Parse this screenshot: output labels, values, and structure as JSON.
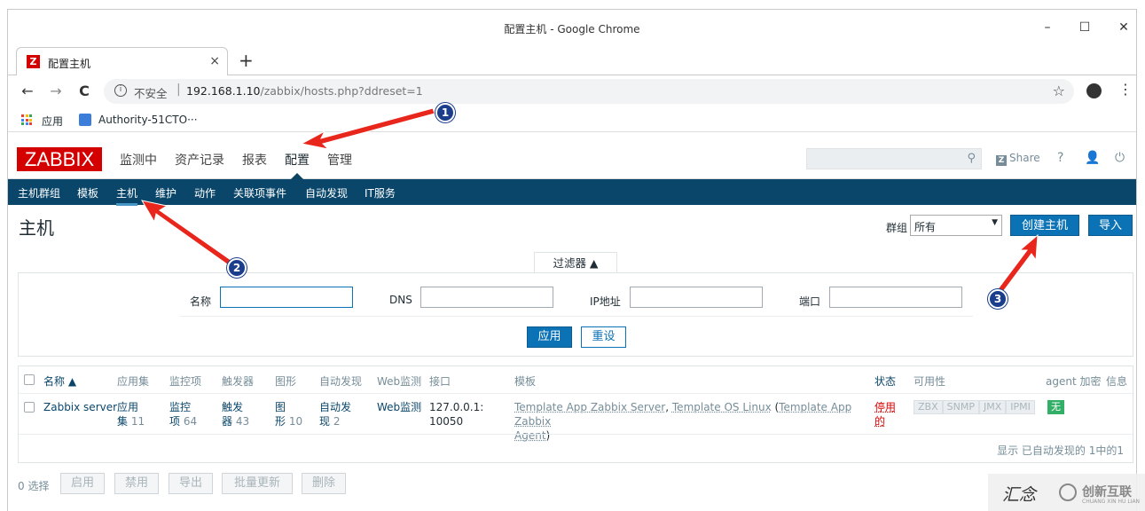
{
  "browser": {
    "window_title": "配置主机 - Google Chrome",
    "controls": {
      "minimize": "–",
      "maximize": "☐",
      "close": "✕"
    },
    "tab": {
      "favicon": "Z",
      "title": "配置主机",
      "close": "×"
    },
    "new_tab": "+",
    "nav": {
      "back": "←",
      "forward": "→",
      "reload": "C"
    },
    "address": {
      "not_secure": "不安全",
      "separator": "|",
      "host": "192.168.1.10",
      "path": "/zabbix/hosts.php?ddreset=1"
    },
    "star": "☆",
    "menu": "⋮",
    "bookmarks": {
      "apps": "应用",
      "authority": "Authority-51CTO···"
    }
  },
  "zabbix": {
    "logo": "ZABBIX",
    "main_menu": [
      "监测中",
      "资产记录",
      "报表",
      "配置",
      "管理"
    ],
    "share": "Share",
    "help": "?",
    "user": "👤",
    "power": "⏻",
    "search_icon": "⚲",
    "submenu": [
      "主机群组",
      "模板",
      "主机",
      "维护",
      "动作",
      "关联项事件",
      "自动发现",
      "IT服务"
    ],
    "page_title": "主机",
    "group_label": "群组",
    "group_value": "所有",
    "group_arrow": "▼",
    "create_host": "创建主机",
    "import": "导入",
    "filter": {
      "tab_label": "过滤器 ▲",
      "name_label": "名称",
      "dns_label": "DNS",
      "ip_label": "IP地址",
      "port_label": "端口",
      "name_value": "",
      "dns_value": "",
      "ip_value": "",
      "port_value": "",
      "apply": "应用",
      "reset": "重设"
    },
    "table": {
      "headers": {
        "name": "名称 ▲",
        "apps": "应用集",
        "items": "监控项",
        "triggers": "触发器",
        "graphs": "图形",
        "discovery": "自动发现",
        "web": "Web监测",
        "interface": "接口",
        "templates": "模板",
        "status": "状态",
        "availability": "可用性",
        "agent_encryption": "agent 加密",
        "info": "信息"
      },
      "row": {
        "name": "Zabbix server",
        "apps_l1": "应用",
        "apps_l2": "集",
        "apps_count": "11",
        "items_l1": "监控",
        "items_l2": "项",
        "items_count": "64",
        "triggers_l1": "触发",
        "triggers_l2": "器",
        "triggers_count": "43",
        "graphs_l1": "图",
        "graphs_l2": "形",
        "graphs_count": "10",
        "discovery_l1": "自动发",
        "discovery_l2": "现",
        "discovery_count": "2",
        "web": "Web监测",
        "interface_l1": "127.0.0.1:",
        "interface_l2": "10050",
        "tmpl_1": "Template App Zabbix Server",
        "tmpl_comma": ", ",
        "tmpl_2": "Template OS Linux",
        "tmpl_paren_open": " (",
        "tmpl_3a": "Template App Zabbix",
        "tmpl_3b": "Agent",
        "tmpl_paren_close": ")",
        "status_l1": "停用",
        "status_l2": "的",
        "avail": [
          "ZBX",
          "SNMP",
          "JMX",
          "IPMI"
        ],
        "encryption": "无"
      },
      "footer": "显示 已自动发现的 1中的1"
    },
    "bottom": {
      "selected": "0 选择",
      "buttons": [
        "启用",
        "禁用",
        "导出",
        "批量更新",
        "删除"
      ]
    }
  },
  "annotations": {
    "markers": [
      "1",
      "2",
      "3"
    ],
    "arrow_color": "#e8261c"
  },
  "watermark": {
    "text1": "汇念",
    "text2": "创新互联",
    "text3": "CHUANG XIN HU LIAN"
  }
}
